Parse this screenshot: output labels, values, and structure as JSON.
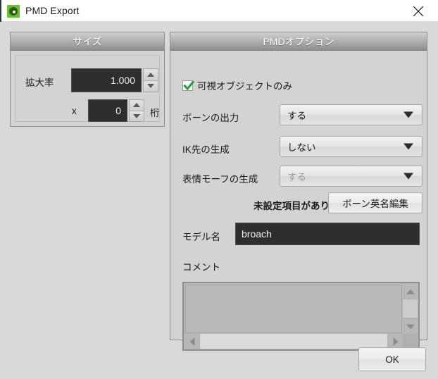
{
  "window": {
    "title": "PMD Export",
    "app_icon": "mqo-green-ring-icon",
    "close_icon": "close-icon",
    "background_color": "#d9d9d9",
    "titlebar_color": "#ffffff",
    "accent_color": "#62c229"
  },
  "size_panel": {
    "title": "サイズ",
    "scale": {
      "label": "拡大率",
      "value": "1.000",
      "spinner_up_icon": "spinner-up-icon",
      "spinner_down_icon": "spinner-down-icon"
    },
    "digits": {
      "multiplier_label": "x",
      "value": "0",
      "unit_label": "桁",
      "spinner_up_icon": "spinner-up-icon",
      "spinner_down_icon": "spinner-down-icon"
    }
  },
  "pmd_panel": {
    "title": "PMDオプション",
    "visible_only": {
      "label": "可視オブジェクトのみ",
      "checked": true,
      "check_icon": "checkmark-icon",
      "check_color": "#2e9e3e"
    },
    "rows": [
      {
        "label": "ボーンの出力",
        "value": "する",
        "disabled": false,
        "arrow_icon": "chevron-down-icon"
      },
      {
        "label": "IK先の生成",
        "value": "しない",
        "disabled": false,
        "arrow_icon": "chevron-down-icon"
      },
      {
        "label": "表情モーフの生成",
        "value": "する",
        "disabled": true,
        "arrow_icon": "chevron-down-icon"
      }
    ],
    "warning_text": "未設定項目があります",
    "bone_english_button": "ボーン英名編集",
    "model_name": {
      "label": "モデル名",
      "value": "broach",
      "placeholder": ""
    },
    "comment": {
      "label": "コメント",
      "value": "",
      "placeholder": "",
      "scroll_up_icon": "scroll-up-icon",
      "scroll_down_icon": "scroll-down-icon",
      "scroll_left_icon": "scroll-left-icon",
      "scroll_right_icon": "scroll-right-icon"
    }
  },
  "footer": {
    "ok_label": "OK"
  }
}
